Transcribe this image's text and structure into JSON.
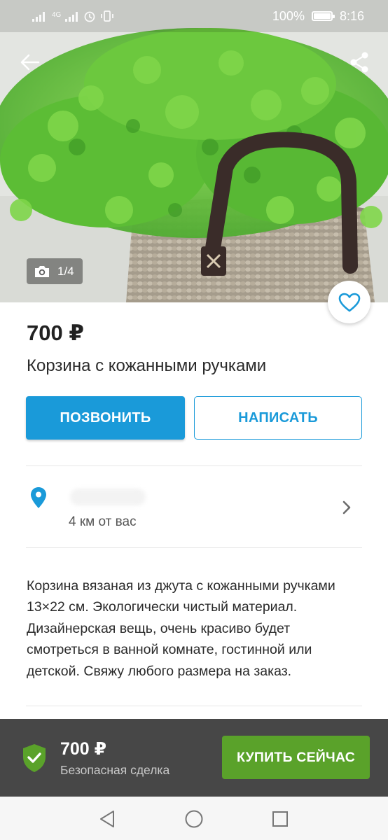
{
  "status_bar": {
    "network": "4G",
    "battery_percent": "100%",
    "battery_level": 1.0,
    "time": "8:16"
  },
  "gallery": {
    "counter": "1/4",
    "current": 1,
    "total": 4
  },
  "listing": {
    "price": "700 ₽",
    "title": "Корзина с кожанными ручками",
    "description": "Корзина вязаная из джута с кожанными ручками 13×22 см. Экологически чистый материал. Дизайнерская вещь, очень красиво будет смотреться в ванной комнате, гостинной или детской. Свяжу любого размера на заказ."
  },
  "actions": {
    "call_label": "ПОЗВОНИТЬ",
    "message_label": "НАПИСАТЬ"
  },
  "location": {
    "distance": "4 км от вас"
  },
  "purchase": {
    "price": "700 ₽",
    "safe_deal_label": "Безопасная сделка",
    "buy_label": "КУПИТЬ СЕЙЧАС"
  },
  "icons": {
    "back": "arrow-left-icon",
    "share": "share-icon",
    "camera": "camera-icon",
    "favorite": "heart-outline-icon",
    "location": "map-pin-icon",
    "chevron": "chevron-right-icon",
    "shield": "shield-check-icon"
  },
  "colors": {
    "accent_blue": "#1a9ad9",
    "buy_green": "#5aa22a",
    "buybar_bg": "#474747",
    "shield_green": "#5aa22a"
  }
}
